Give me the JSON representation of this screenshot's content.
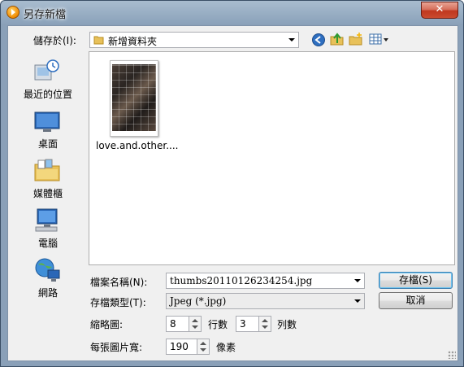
{
  "window": {
    "title": "另存新檔",
    "close_label": "✕"
  },
  "toolbar": {
    "save_in_label": "儲存於(I):",
    "current_folder": "新增資料夾"
  },
  "places": [
    {
      "label": "最近的位置",
      "icon": "recent-places-icon"
    },
    {
      "label": "桌面",
      "icon": "desktop-icon"
    },
    {
      "label": "媒體櫃",
      "icon": "libraries-icon"
    },
    {
      "label": "電腦",
      "icon": "computer-icon"
    },
    {
      "label": "網路",
      "icon": "network-icon"
    }
  ],
  "files": [
    {
      "name": "love.and.other...."
    }
  ],
  "form": {
    "filename_label": "檔案名稱(N):",
    "filename_value": "thumbs20110126234254.jpg",
    "filetype_label": "存檔類型(T):",
    "filetype_value": "Jpeg (*.jpg)",
    "thumbs_label": "縮略圖:",
    "rows_value": "8",
    "rows_unit": "行數",
    "cols_value": "3",
    "cols_unit": "列數",
    "width_label": "每張圖片寬:",
    "width_value": "190",
    "width_unit": "像素"
  },
  "buttons": {
    "save": "存檔(S)",
    "cancel": "取消"
  },
  "colors": {
    "accent": "#3c7fb1",
    "close": "#c94a2e",
    "folder": "#e8c15a"
  }
}
